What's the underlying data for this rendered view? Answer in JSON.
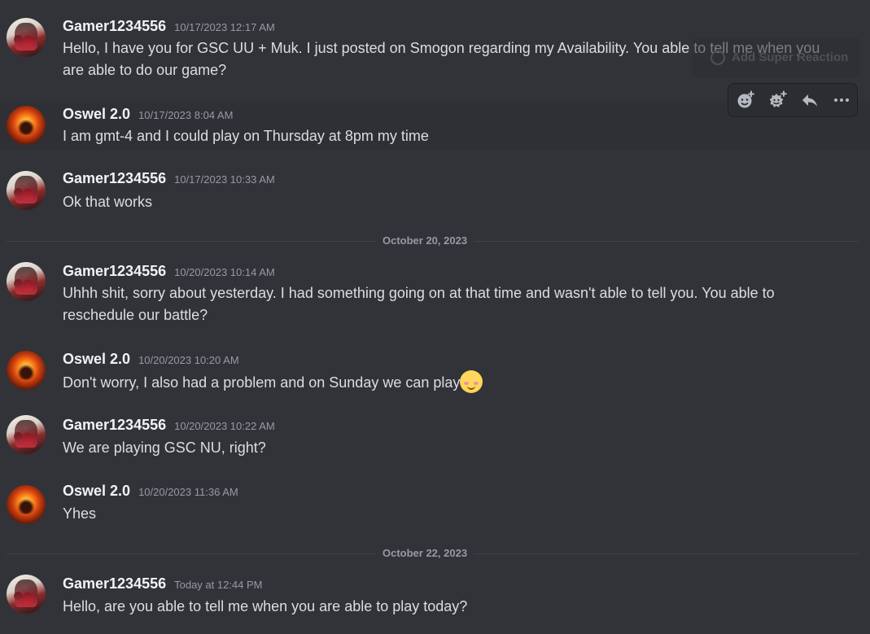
{
  "messages": [
    {
      "author": "Gamer1234556",
      "time": "10/17/2023 12:17 AM",
      "text": "Hello, I have you for GSC UU + Muk. I just posted on Smogon regarding my Availability. You able to tell me when you are able to do our game?"
    },
    {
      "author": "Oswel 2.0",
      "time": "10/17/2023 8:04 AM",
      "text": "I am gmt-4 and I could play on Thursday at 8pm my time"
    },
    {
      "author": "Gamer1234556",
      "time": "10/17/2023 10:33 AM",
      "text": "Ok that works"
    },
    {
      "author": "Gamer1234556",
      "time": "10/20/2023 10:14 AM",
      "text": "Uhhh shit, sorry about yesterday. I had something going on at that time and wasn't able to tell you. You able to reschedule our battle?"
    },
    {
      "author": "Oswel 2.0",
      "time": "10/20/2023 10:20 AM",
      "text": "Don't worry, I also had a problem and on Sunday we can play"
    },
    {
      "author": "Gamer1234556",
      "time": "10/20/2023 10:22 AM",
      "text": "We are playing GSC NU, right?"
    },
    {
      "author": "Oswel 2.0",
      "time": "10/20/2023 11:36 AM",
      "text": "Yhes"
    },
    {
      "author": "Gamer1234556",
      "time": "Today at 12:44 PM",
      "text": "Hello, are you able to tell me when you are able to play today?"
    }
  ],
  "dividers": [
    "October 20, 2023",
    "October 22, 2023"
  ],
  "hover": {
    "super_reaction_label": "Add Super Reaction",
    "toolbar_icons": [
      "add-reaction-icon",
      "add-super-reaction-icon",
      "reply-icon",
      "more-options-icon"
    ]
  },
  "emoji": "smiling-face-with-blush-emoji",
  "colors": {
    "background": "#313338",
    "username": "#f2f3f5",
    "message_text": "#dbdee1",
    "timestamp": "#949ba4",
    "divider": "#3f4147",
    "toolbar_bg": "#2b2d31"
  }
}
